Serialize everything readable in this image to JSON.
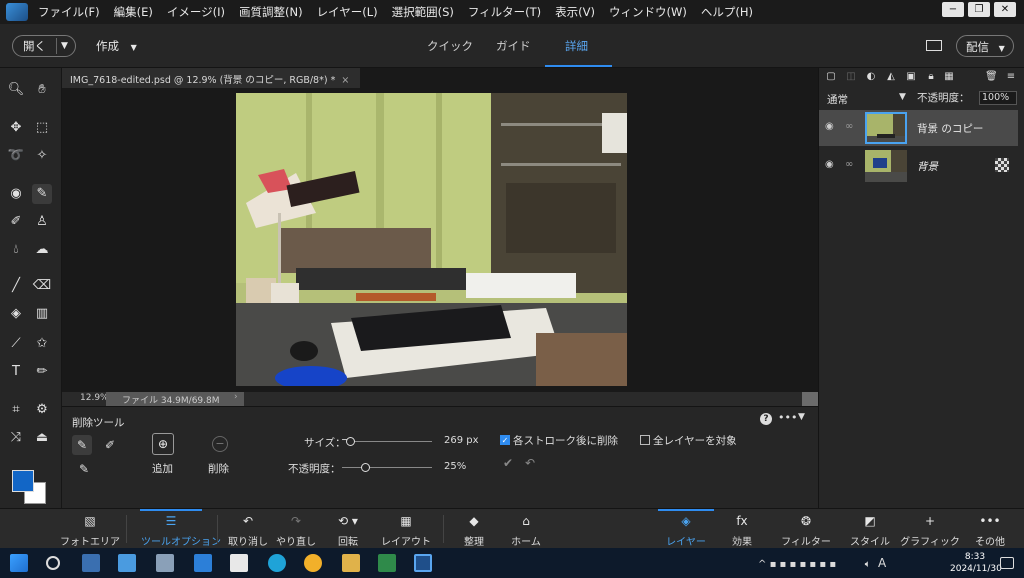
{
  "menubar": {
    "items": [
      "ファイル(F)",
      "編集(E)",
      "イメージ(I)",
      "画質調整(N)",
      "レイヤー(L)",
      "選択範囲(S)",
      "フィルター(T)",
      "表示(V)",
      "ウィンドウ(W)",
      "ヘルプ(H)"
    ],
    "window_controls": [
      "−",
      "❐",
      "✕"
    ]
  },
  "topbar": {
    "open_label": "開く",
    "create_label": "作成",
    "tabs": [
      "クイック",
      "ガイド",
      "詳細"
    ],
    "active_tab": "詳細",
    "share_label": "配信"
  },
  "document": {
    "tab_title": "IMG_7618-edited.psd @ 12.9% (背景 のコピー, RGB/8*) *",
    "close": "×",
    "zoom": "12.9%",
    "file_info": "ファイル 34.9M/69.8M",
    "file_arrow": "›"
  },
  "layers": {
    "blend_mode": "通常",
    "opacity_label": "不透明度：",
    "opacity_value": "100%",
    "items": [
      {
        "name": "背景 のコピー",
        "selected": true
      },
      {
        "name": "背景",
        "selected": false
      }
    ]
  },
  "tool_options": {
    "title": "削除ツール",
    "add_label": "追加",
    "delete_label": "削除",
    "size_label": "サイズ：",
    "size_value": "269 px",
    "size_level": 0.02,
    "opacity_label": "不透明度：",
    "opacity_value": "25%",
    "opacity_level": 0.25,
    "each_stroke_label": "各ストローク後に削除",
    "each_stroke_checked": true,
    "all_layers_label": "全レイヤーを対象",
    "all_layers_checked": false
  },
  "bottombar": {
    "left": [
      {
        "label": "フォトエリア",
        "icon": "photo-bin-icon"
      },
      {
        "label": "ツールオプション",
        "icon": "tool-options-icon",
        "active": true
      },
      {
        "label": "取り消し",
        "icon": "undo-icon"
      },
      {
        "label": "やり直し",
        "icon": "redo-icon"
      },
      {
        "label": "回転",
        "icon": "rotate-icon"
      },
      {
        "label": "レイアウト",
        "icon": "layout-icon"
      },
      {
        "label": "整理",
        "icon": "organizer-icon"
      },
      {
        "label": "ホーム",
        "icon": "home-icon"
      }
    ],
    "right": [
      {
        "label": "レイヤー",
        "icon": "layers-icon",
        "active": true
      },
      {
        "label": "効果",
        "icon": "fx-icon"
      },
      {
        "label": "フィルター",
        "icon": "filter-icon"
      },
      {
        "label": "スタイル",
        "icon": "style-icon"
      },
      {
        "label": "グラフィック",
        "icon": "graphics-icon"
      },
      {
        "label": "その他",
        "icon": "more-icon"
      }
    ]
  },
  "taskbar": {
    "ime": "A",
    "time": "8:33",
    "date": "2024/11/30"
  },
  "colors": {
    "accent": "#2f8cf0",
    "foreground": "#1266c6",
    "background": "#ffffff"
  }
}
